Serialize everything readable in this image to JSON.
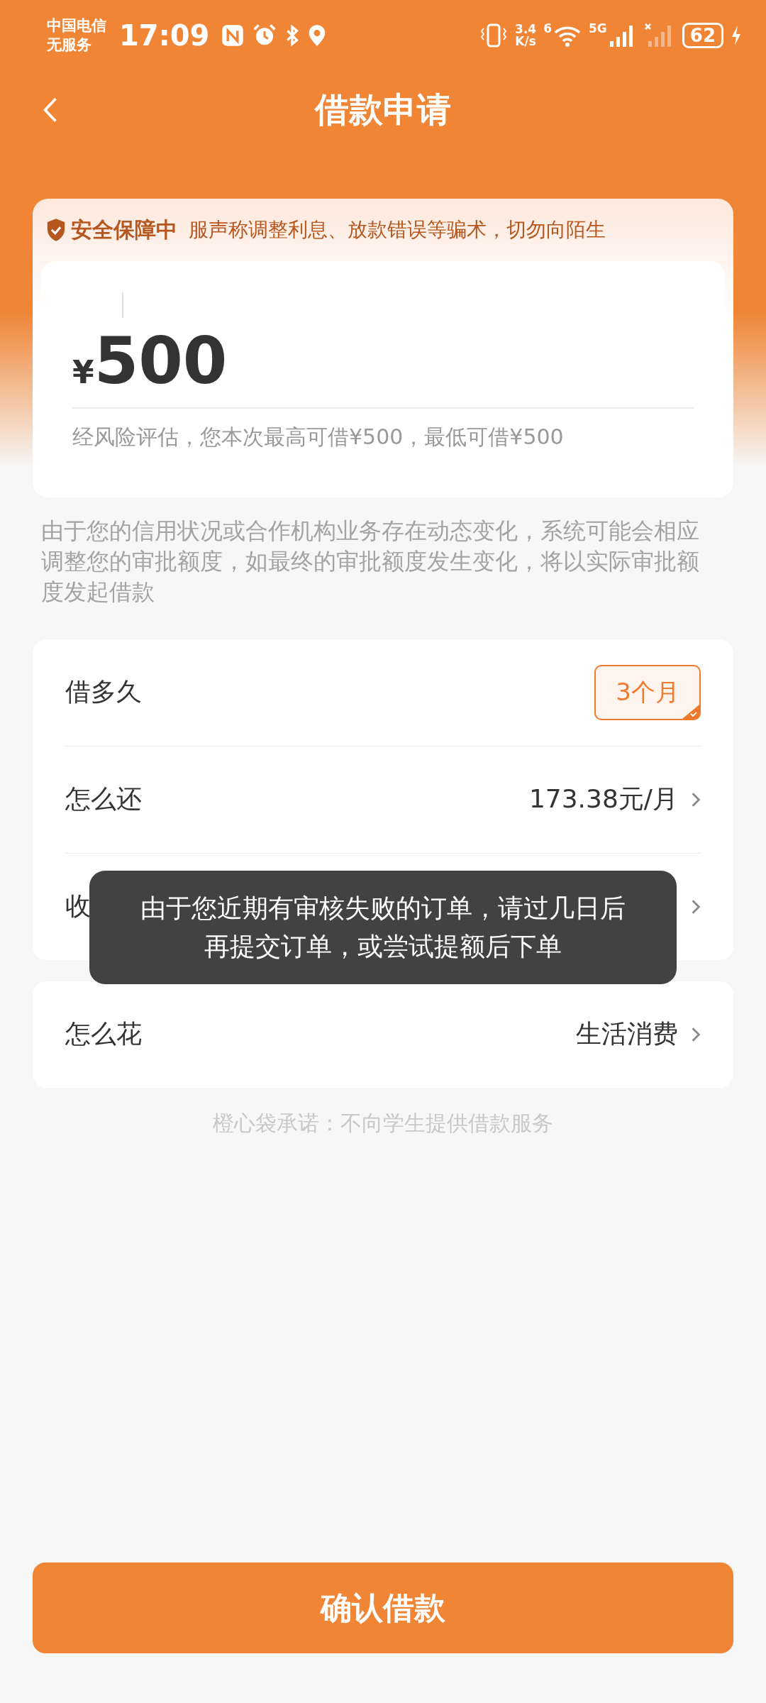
{
  "status_bar": {
    "carrier": "中国电信",
    "service": "无服务",
    "time": "17:09",
    "speed_value": "3.4",
    "speed_unit": "K/s",
    "wifi_badge": "6",
    "network": "5G",
    "battery": "62"
  },
  "header": {
    "title": "借款申请"
  },
  "security": {
    "badge": "安全保障中",
    "notice": "服声称调整利息、放款错误等骗术，切勿向陌生"
  },
  "amount": {
    "currency": "¥",
    "value": "500",
    "hint": "经风险评估，您本次最高可借¥500，最低可借¥500"
  },
  "disclaimer": "由于您的信用状况或合作机构业务存在动态变化，系统可能会相应调整您的审批额度，如最终的审批额度发生变化，将以实际审批额度发起借款",
  "rows": [
    {
      "kind": "option",
      "label": "借多久",
      "value": "3个月",
      "selected": true
    },
    {
      "kind": "link",
      "label": "怎么还",
      "value": "173.38元/月"
    },
    {
      "kind": "covered",
      "label": "收"
    }
  ],
  "purpose": {
    "label": "怎么花",
    "value": "生活消费"
  },
  "promise": "橙心袋承诺：不向学生提供借款服务",
  "toast": "由于您近期有审核失败的订单，请过几日后再提交订单，或尝试提额后下单",
  "submit": "确认借款"
}
